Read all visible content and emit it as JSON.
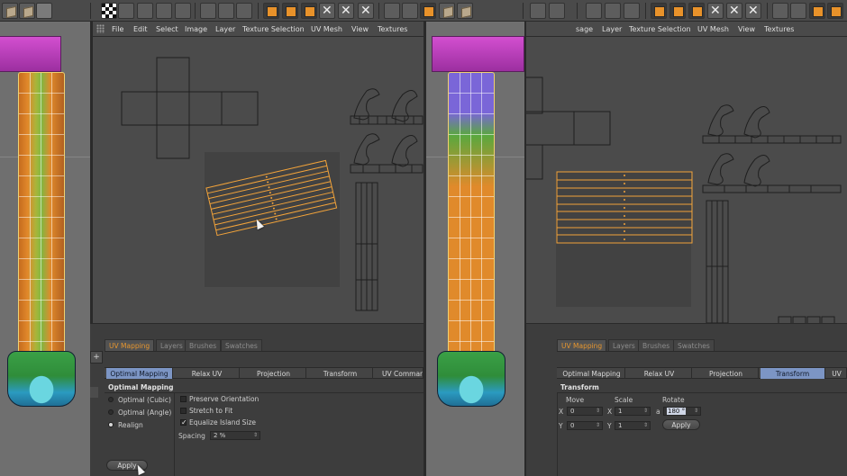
{
  "left_uv_window": {
    "menu": [
      "File",
      "Edit",
      "Select",
      "Image",
      "Layer",
      "Texture Selection",
      "UV Mesh",
      "View",
      "Textures"
    ],
    "panel_tabs": [
      {
        "label": "UV Mapping",
        "active": true
      },
      {
        "label": "Layers",
        "active": false
      },
      {
        "label": "Brushes",
        "active": false
      },
      {
        "label": "Swatches",
        "active": false
      }
    ],
    "sub_tabs": [
      {
        "label": "Optimal Mapping",
        "active": true
      },
      {
        "label": "Relax UV",
        "active": false
      },
      {
        "label": "Projection",
        "active": false
      },
      {
        "label": "Transform",
        "active": false
      },
      {
        "label": "UV Commands",
        "active": false
      }
    ],
    "section_title": "Optimal Mapping",
    "mode_options": [
      {
        "label": "Optimal (Cubic)",
        "selected": false
      },
      {
        "label": "Optimal (Angle)",
        "selected": false
      },
      {
        "label": "Realign",
        "selected": true
      }
    ],
    "checkboxes": [
      {
        "label": "Preserve Orientation",
        "checked": false
      },
      {
        "label": "Stretch to Fit",
        "checked": false
      },
      {
        "label": "Equalize Island Size",
        "checked": true
      }
    ],
    "spacing": {
      "label": "Spacing",
      "value": "2 %"
    },
    "apply_label": "Apply"
  },
  "right_uv_window": {
    "menu": [
      "sage",
      "Layer",
      "Texture Selection",
      "UV Mesh",
      "View",
      "Textures"
    ],
    "panel_tabs": [
      {
        "label": "UV Mapping",
        "active": true
      },
      {
        "label": "Layers",
        "active": false
      },
      {
        "label": "Brushes",
        "active": false
      },
      {
        "label": "Swatches",
        "active": false
      }
    ],
    "sub_tabs": [
      {
        "label": "Optimal Mapping",
        "active": false
      },
      {
        "label": "Relax UV",
        "active": false
      },
      {
        "label": "Projection",
        "active": false
      },
      {
        "label": "Transform",
        "active": true
      },
      {
        "label": "UV",
        "active": false
      }
    ],
    "section_title": "Transform",
    "columns": {
      "move": "Move",
      "scale": "Scale",
      "rotate": "Rotate"
    },
    "move": {
      "x": "0",
      "y": "0"
    },
    "scale": {
      "x": "1",
      "y": "1"
    },
    "rotate": {
      "axis": "a",
      "value": "180 °"
    },
    "axis_labels": {
      "x": "X",
      "y": "Y"
    },
    "apply_label": "Apply"
  },
  "colors": {
    "accent_orange": "#e6962f",
    "active_subtab": "#7c95c4",
    "uv_island_stroke": "#f2a33a",
    "pillar_cap": "#c94ac6"
  }
}
